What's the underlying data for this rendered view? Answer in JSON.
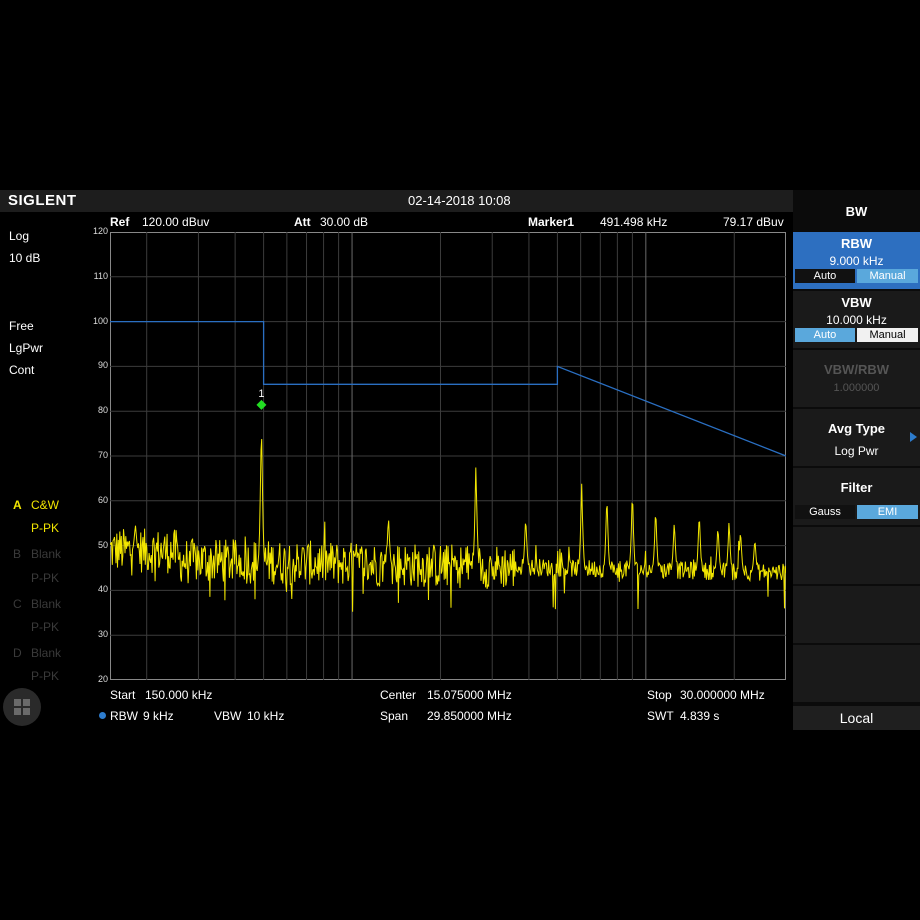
{
  "brand": "SIGLENT",
  "datetime": "02-14-2018 10:08",
  "header": {
    "ref_label": "Ref",
    "ref_value": "120.00 dBuv",
    "att_label": "Att",
    "att_value": "30.00 dB",
    "marker_label": "Marker1",
    "marker_freq": "491.498 kHz",
    "marker_level": "79.17 dBuv"
  },
  "left_status": {
    "scale": "Log",
    "div": "10 dB",
    "trig": "Free",
    "det": "LgPwr",
    "sweep": "Cont"
  },
  "traces": [
    {
      "name": "A",
      "mode": "C&W",
      "det": "P-PK",
      "active": true
    },
    {
      "name": "B",
      "mode": "Blank",
      "det": "P-PK",
      "active": false
    },
    {
      "name": "C",
      "mode": "Blank",
      "det": "P-PK",
      "active": false
    },
    {
      "name": "D",
      "mode": "Blank",
      "det": "P-PK",
      "active": false
    }
  ],
  "footer": {
    "start_label": "Start",
    "start_value": "150.000 kHz",
    "center_label": "Center",
    "center_value": "15.075000 MHz",
    "stop_label": "Stop",
    "stop_value": "30.000000 MHz",
    "rbw_label": "RBW",
    "rbw_value": "9 kHz",
    "vbw_label": "VBW",
    "vbw_value": "10 kHz",
    "span_label": "Span",
    "span_value": "29.850000 MHz",
    "swt_label": "SWT",
    "swt_value": "4.839 s"
  },
  "menu": {
    "title": "BW",
    "rbw": {
      "label": "RBW",
      "value": "9.000 kHz",
      "auto": "Auto",
      "manual": "Manual",
      "selected": "Manual"
    },
    "vbw": {
      "label": "VBW",
      "value": "10.000 kHz",
      "auto": "Auto",
      "manual": "Manual",
      "selected": "Auto"
    },
    "ratio": {
      "label": "VBW/RBW",
      "value": "1.000000"
    },
    "avg_type": {
      "label": "Avg Type",
      "value": "Log Pwr"
    },
    "filter": {
      "label": "Filter",
      "gauss": "Gauss",
      "emi": "EMI",
      "selected": "EMI"
    },
    "local": "Local"
  },
  "colors": {
    "trace": "#f2e600",
    "limit_line": "#2a6fc2",
    "marker": "#22dd22",
    "accent": "#2d7ccd"
  },
  "chart_data": {
    "type": "line",
    "x_scale": "log",
    "x_range_hz": [
      150000,
      30000000
    ],
    "ylim": [
      20,
      120
    ],
    "yticks": [
      20,
      30,
      40,
      50,
      60,
      70,
      80,
      90,
      100,
      110,
      120
    ],
    "y_unit": "dBuv",
    "grid": true,
    "limit_line": [
      {
        "x_hz": 150000,
        "y": 100
      },
      {
        "x_hz": 500000,
        "y": 100
      },
      {
        "x_hz": 500000,
        "y": 86
      },
      {
        "x_hz": 5000000,
        "y": 86
      },
      {
        "x_hz": 5000000,
        "y": 90
      },
      {
        "x_hz": 30000000,
        "y": 70
      }
    ],
    "marker": {
      "label": "1",
      "x_hz": 491498,
      "y": 79.17
    },
    "peaks": [
      {
        "x_hz": 183000,
        "y": 55
      },
      {
        "x_hz": 491498,
        "y": 79.2
      },
      {
        "x_hz": 1330000,
        "y": 57
      },
      {
        "x_hz": 2640000,
        "y": 69
      },
      {
        "x_hz": 3900000,
        "y": 57
      },
      {
        "x_hz": 6050000,
        "y": 64
      },
      {
        "x_hz": 7370000,
        "y": 62
      },
      {
        "x_hz": 9000000,
        "y": 63
      },
      {
        "x_hz": 10800000,
        "y": 59
      },
      {
        "x_hz": 12500000,
        "y": 56
      },
      {
        "x_hz": 15200000,
        "y": 58
      },
      {
        "x_hz": 17600000,
        "y": 55
      },
      {
        "x_hz": 19200000,
        "y": 56
      },
      {
        "x_hz": 21000000,
        "y": 54
      },
      {
        "x_hz": 23500000,
        "y": 52
      }
    ],
    "noise_floor": {
      "start_y": 47,
      "end_y": 44
    }
  }
}
